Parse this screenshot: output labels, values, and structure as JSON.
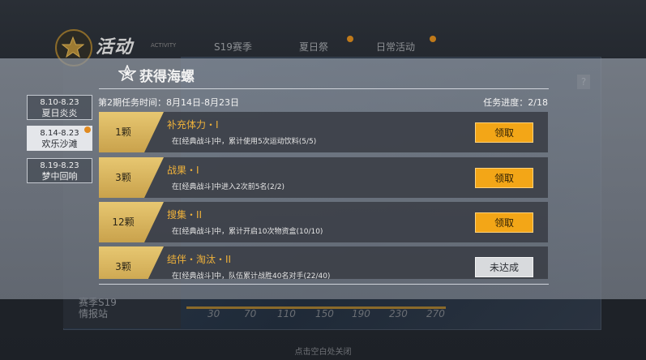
{
  "background": {
    "title": "活动",
    "subtitle": "ACTIVITY",
    "tabs": [
      {
        "label": "S19赛季"
      },
      {
        "label": "夏日祭"
      },
      {
        "label": "日常活动"
      }
    ],
    "help_label": "?",
    "season_label": "赛季S19",
    "season_sub": "情报站",
    "axis_ticks": [
      "30",
      "70",
      "110",
      "150",
      "190",
      "230",
      "270"
    ],
    "close_hint": "点击空白处关闭"
  },
  "popup": {
    "title": "获得海螺",
    "period_text": "第2期任务时间：8月14日-8月23日",
    "progress_text": "任务进度：2/18",
    "period_tabs": [
      {
        "dates": "8.10-8.23",
        "name": "夏日炎炎",
        "active": false
      },
      {
        "dates": "8.14-8.23",
        "name": "欢乐沙滩",
        "active": true
      },
      {
        "dates": "8.19-8.23",
        "name": "梦中回响",
        "active": false
      }
    ],
    "tasks": [
      {
        "reward": "1颗",
        "name": "补充体力・I",
        "desc": "在[经典战斗]中，累计使用5次运动饮料(5/5)",
        "button": "领取",
        "state": "claim"
      },
      {
        "reward": "3颗",
        "name": "战果・I",
        "desc": "在[经典战斗]中进入2次前5名(2/2)",
        "button": "领取",
        "state": "claim"
      },
      {
        "reward": "12颗",
        "name": "搜集・II",
        "desc": "在[经典战斗]中，累计开启10次物资盒(10/10)",
        "button": "领取",
        "state": "claim"
      },
      {
        "reward": "3颗",
        "name": "结伴・淘汰・II",
        "desc": "在[经典战斗]中，队伍累计战胜40名对手(22/40)",
        "button": "未达成",
        "state": "notyet"
      }
    ]
  },
  "colors": {
    "accent_orange": "#f3a617",
    "task_name": "#f0b23a",
    "reward_gold": "#e7c771"
  }
}
